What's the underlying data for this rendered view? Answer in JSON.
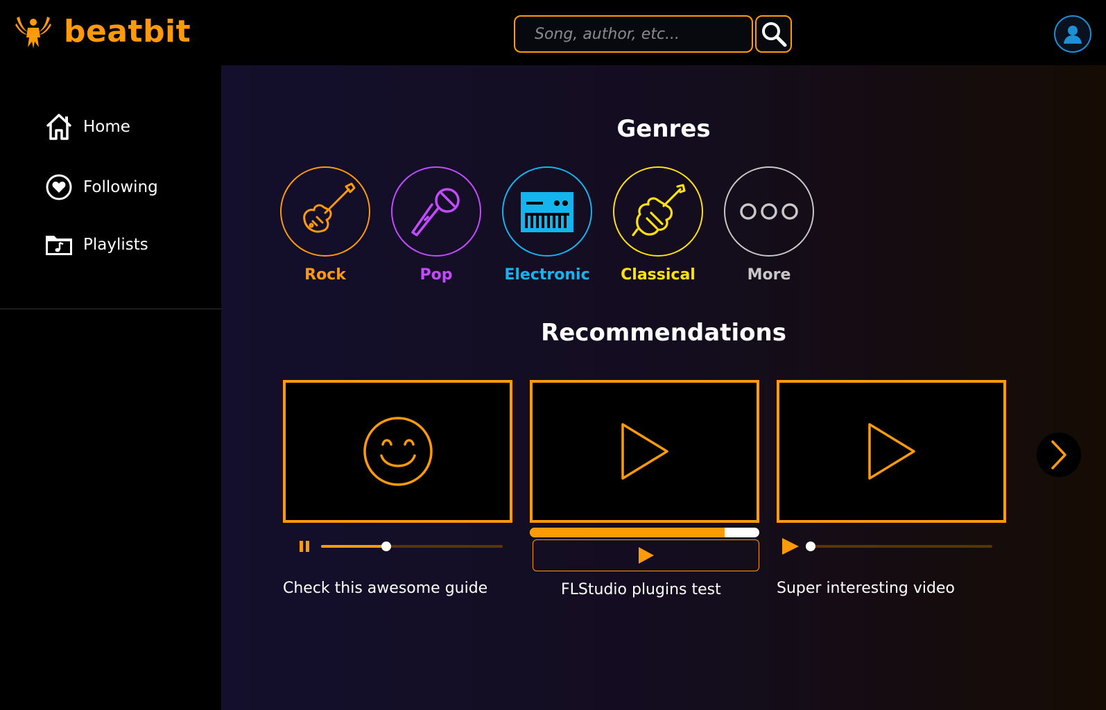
{
  "app": {
    "name": "beatbit",
    "brand_color": "#ff9a0a"
  },
  "search": {
    "placeholder": "Song, author, etc..."
  },
  "sidebar": {
    "items": [
      {
        "label": "Home",
        "icon": "home-icon"
      },
      {
        "label": "Following",
        "icon": "heart-icon"
      },
      {
        "label": "Playlists",
        "icon": "music-folder-icon"
      }
    ]
  },
  "genres": {
    "title": "Genres",
    "items": [
      {
        "label": "Rock",
        "icon": "guitar-icon",
        "color": "#ff9a0a"
      },
      {
        "label": "Pop",
        "icon": "microphone-icon",
        "color": "#c44bff"
      },
      {
        "label": "Electronic",
        "icon": "synthesizer-icon",
        "color": "#14b4ef"
      },
      {
        "label": "Classical",
        "icon": "violin-icon",
        "color": "#ffe20a"
      },
      {
        "label": "More",
        "icon": "more-icon",
        "color": "#c8c8c8"
      }
    ]
  },
  "recommendations": {
    "title": "Recommendations",
    "items": [
      {
        "title": "Check this awesome guide",
        "thumbnail_icon": "smiley-icon",
        "control": "pause-icon",
        "progress": 0.36
      },
      {
        "title": "FLStudio plugins test",
        "thumbnail_icon": "play-icon",
        "control": "play-icon",
        "progress": 0.85
      },
      {
        "title": "Super interesting video",
        "thumbnail_icon": "play-icon",
        "control": "play-icon",
        "progress": 0.0
      }
    ],
    "next_icon": "chevron-right-icon"
  }
}
